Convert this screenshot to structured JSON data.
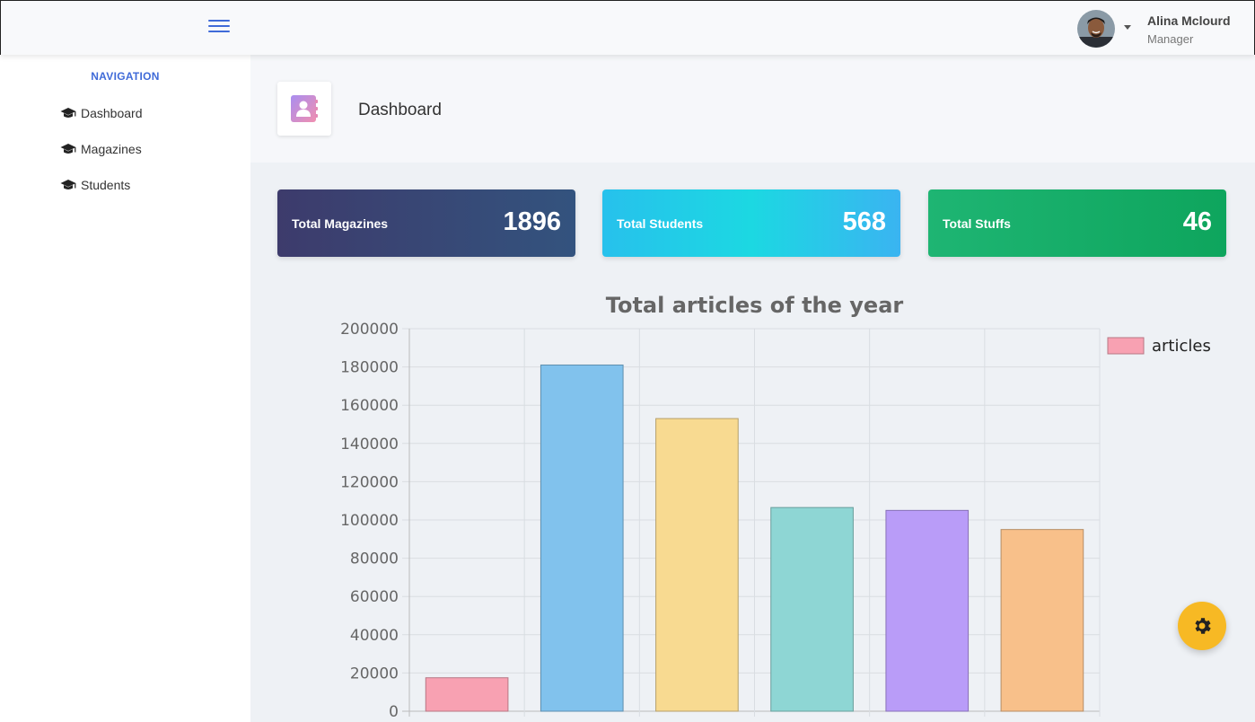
{
  "header": {
    "user_name": "Alina Mclourd",
    "user_role": "Manager",
    "accent": "#3f6ad8"
  },
  "sidebar": {
    "heading": "NAVIGATION",
    "items": [
      {
        "label": "Dashboard",
        "icon": "graduation-cap-icon"
      },
      {
        "label": "Magazines",
        "icon": "graduation-cap-icon"
      },
      {
        "label": "Students",
        "icon": "graduation-cap-icon"
      }
    ]
  },
  "page": {
    "title": "Dashboard",
    "icon": "contact-book-icon"
  },
  "cards": [
    {
      "label": "Total Magazines",
      "value": "1896",
      "color": "#3b4272"
    },
    {
      "label": "Total Students",
      "value": "568",
      "color": "#1fcfe6"
    },
    {
      "label": "Total Stuffs",
      "value": "46",
      "color": "#16ad66"
    }
  ],
  "chart_data": {
    "type": "bar",
    "title": "Total articles of the year",
    "ylim": [
      0,
      200000
    ],
    "yticks": [
      0,
      20000,
      40000,
      60000,
      80000,
      100000,
      120000,
      140000,
      160000,
      180000,
      200000
    ],
    "series": [
      {
        "name": "articles",
        "values": [
          17500,
          181000,
          153000,
          106500,
          105000,
          95000
        ]
      }
    ],
    "bar_colors": [
      "#f8a1b2",
      "#81c2ed",
      "#f8da91",
      "#8ed6d4",
      "#b99cf8",
      "#f8c08a"
    ],
    "bar_borders": [
      "#b77684",
      "#5e8eae",
      "#b59f6a",
      "#689e9c",
      "#8872b7",
      "#b68d65"
    ],
    "grid": true,
    "legend": "top-right"
  },
  "fab": {
    "icon": "gear-icon",
    "color": "#f7b924"
  }
}
